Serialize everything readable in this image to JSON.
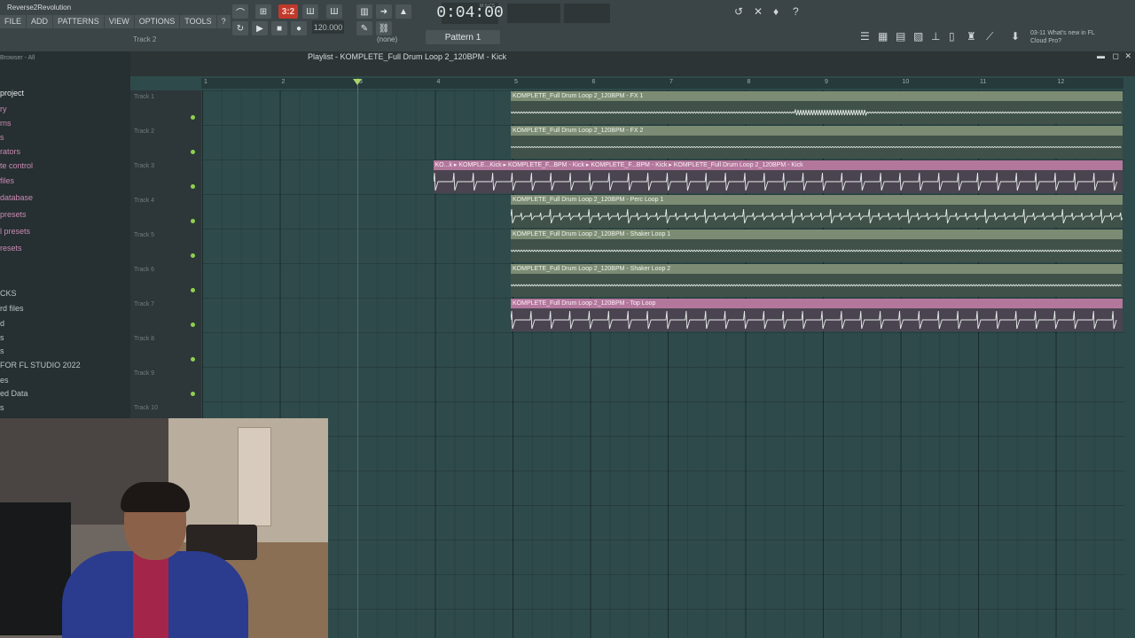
{
  "topbar": {
    "project_name": "Reverse2Revolution",
    "menu": [
      "FILE",
      "ADD",
      "PATTERNS",
      "VIEW",
      "OPTIONS",
      "TOOLS",
      "?"
    ],
    "hint": "Track 2",
    "song_mode_label": "3:2",
    "time": "0:04:00",
    "time_unit": "M:S:CS",
    "tempo": "120.000",
    "snap": "(none)",
    "pattern": "Pattern 1",
    "whats_new": "03-11  What's new in FL Cloud Pro?"
  },
  "browser": {
    "header": "Browser - All",
    "items": [
      {
        "label": "project",
        "color": "#e6eaeb"
      },
      {
        "label": "ry",
        "color": "#c98bb4"
      },
      {
        "label": "rns",
        "color": "#c98bb4"
      },
      {
        "label": "s",
        "color": "#c98bb4"
      },
      {
        "label": "rators",
        "color": "#c98bb4"
      },
      {
        "label": "te control",
        "color": "#c98bb4"
      },
      {
        "label": "files",
        "color": "#c98bb4"
      },
      {
        "label": "database",
        "color": "#c98bb4"
      },
      {
        "label": "presets",
        "color": "#c98bb4"
      },
      {
        "label": "l presets",
        "color": "#c98bb4"
      },
      {
        "label": "resets",
        "color": "#c98bb4"
      },
      {
        "label": "CKS",
        "color": "#b9c3c5"
      },
      {
        "label": "rd files",
        "color": "#b9c3c5"
      },
      {
        "label": "d",
        "color": "#b9c3c5"
      },
      {
        "label": "s",
        "color": "#b9c3c5"
      },
      {
        "label": "s",
        "color": "#b9c3c5"
      },
      {
        "label": "FOR FL STUDIO 2022",
        "color": "#b9c3c5"
      },
      {
        "label": "es",
        "color": "#b9c3c5"
      },
      {
        "label": "ed Data",
        "color": "#b9c3c5"
      },
      {
        "label": "s",
        "color": "#b9c3c5"
      }
    ]
  },
  "playlist": {
    "title": "Playlist - KOMPLETE_Full Drum Loop 2_120BPM - Kick",
    "bars": [
      "1",
      "2",
      "3",
      "4",
      "5",
      "6",
      "7",
      "8",
      "9",
      "10",
      "11",
      "12"
    ],
    "tracks": [
      "Track 1",
      "Track 2",
      "Track 3",
      "Track 4",
      "Track 5",
      "Track 6",
      "Track 7",
      "Track 8",
      "Track 9",
      "Track 10"
    ],
    "clips": [
      {
        "track": 1,
        "label": "KOMPLETE_Full Drum Loop 2_120BPM - FX 1",
        "color": "green",
        "wave": "fx1"
      },
      {
        "track": 2,
        "label": "KOMPLETE_Full Drum Loop 2_120BPM - FX 2",
        "color": "green",
        "wave": "fx2"
      },
      {
        "track": 3,
        "label": "KO...k  ▸ KOMPLE...Kick  ▸ KOMPLETE_F...BPM - Kick  ▸ KOMPLETE_F...BPM - Kick  ▸ KOMPLETE_Full Drum Loop 2_120BPM - Kick",
        "color": "pink",
        "wave": "kick"
      },
      {
        "track": 4,
        "label": "KOMPLETE_Full Drum Loop 2_120BPM - Perc Loop 1",
        "color": "green",
        "wave": "perc"
      },
      {
        "track": 5,
        "label": "KOMPLETE_Full Drum Loop 2_120BPM - Shaker Loop 1",
        "color": "green",
        "wave": "shaker"
      },
      {
        "track": 6,
        "label": "KOMPLETE_Full Drum Loop 2_120BPM - Shaker Loop 2",
        "color": "green",
        "wave": "shaker2"
      },
      {
        "track": 7,
        "label": "KOMPLETE_Full Drum Loop 2_120BPM - Top Loop",
        "color": "pink",
        "wave": "top"
      }
    ]
  },
  "colors": {
    "accent_green": "#8fd14f",
    "clip_green": "#7c8c74",
    "clip_pink": "#b3779c",
    "record_red": "#c0392b"
  }
}
